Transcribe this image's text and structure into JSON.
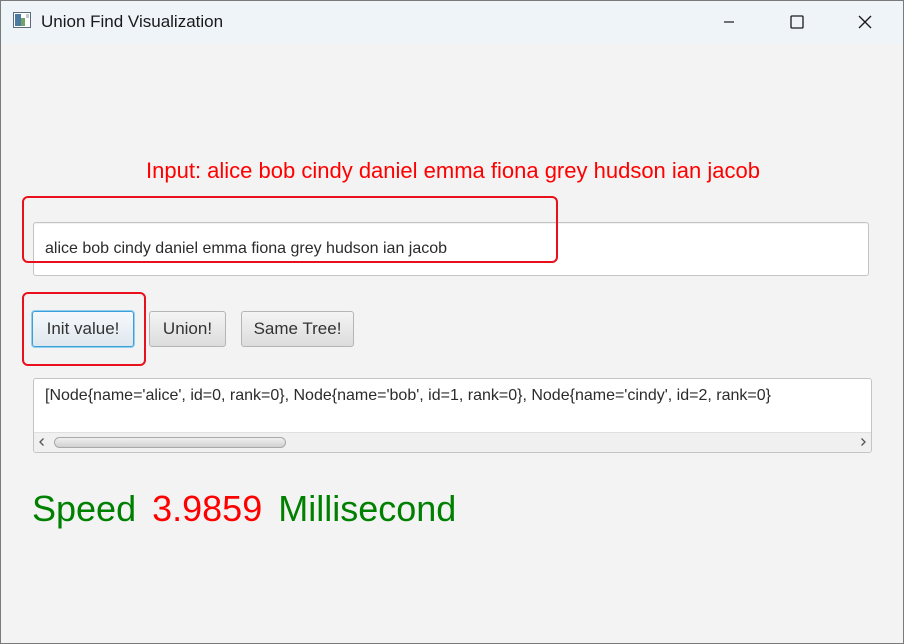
{
  "window": {
    "title": "Union Find Visualization",
    "icon": "java-app-icon",
    "controls": [
      "minimize-icon",
      "maximize-icon",
      "close-icon"
    ]
  },
  "input_caption": "Input: alice bob cindy daniel emma fiona grey hudson ian jacob",
  "input_field": {
    "value": "alice bob cindy daniel emma fiona grey hudson ian jacob"
  },
  "buttons": {
    "init": "Init value!",
    "union": "Union!",
    "same_tree": "Same Tree!"
  },
  "output": {
    "text": "[Node{name='alice', id=0, rank=0}, Node{name='bob', id=1, rank=0}, Node{name='cindy', id=2, rank=0}"
  },
  "speed": {
    "label": "Speed",
    "value": "3.9859",
    "unit": "Millisecond"
  },
  "colors": {
    "caption": "#ff0000",
    "speed_label": "#008000",
    "speed_value": "#ff0000",
    "highlight_box": "#e8101a",
    "focus_accent": "#3d9fd8"
  }
}
